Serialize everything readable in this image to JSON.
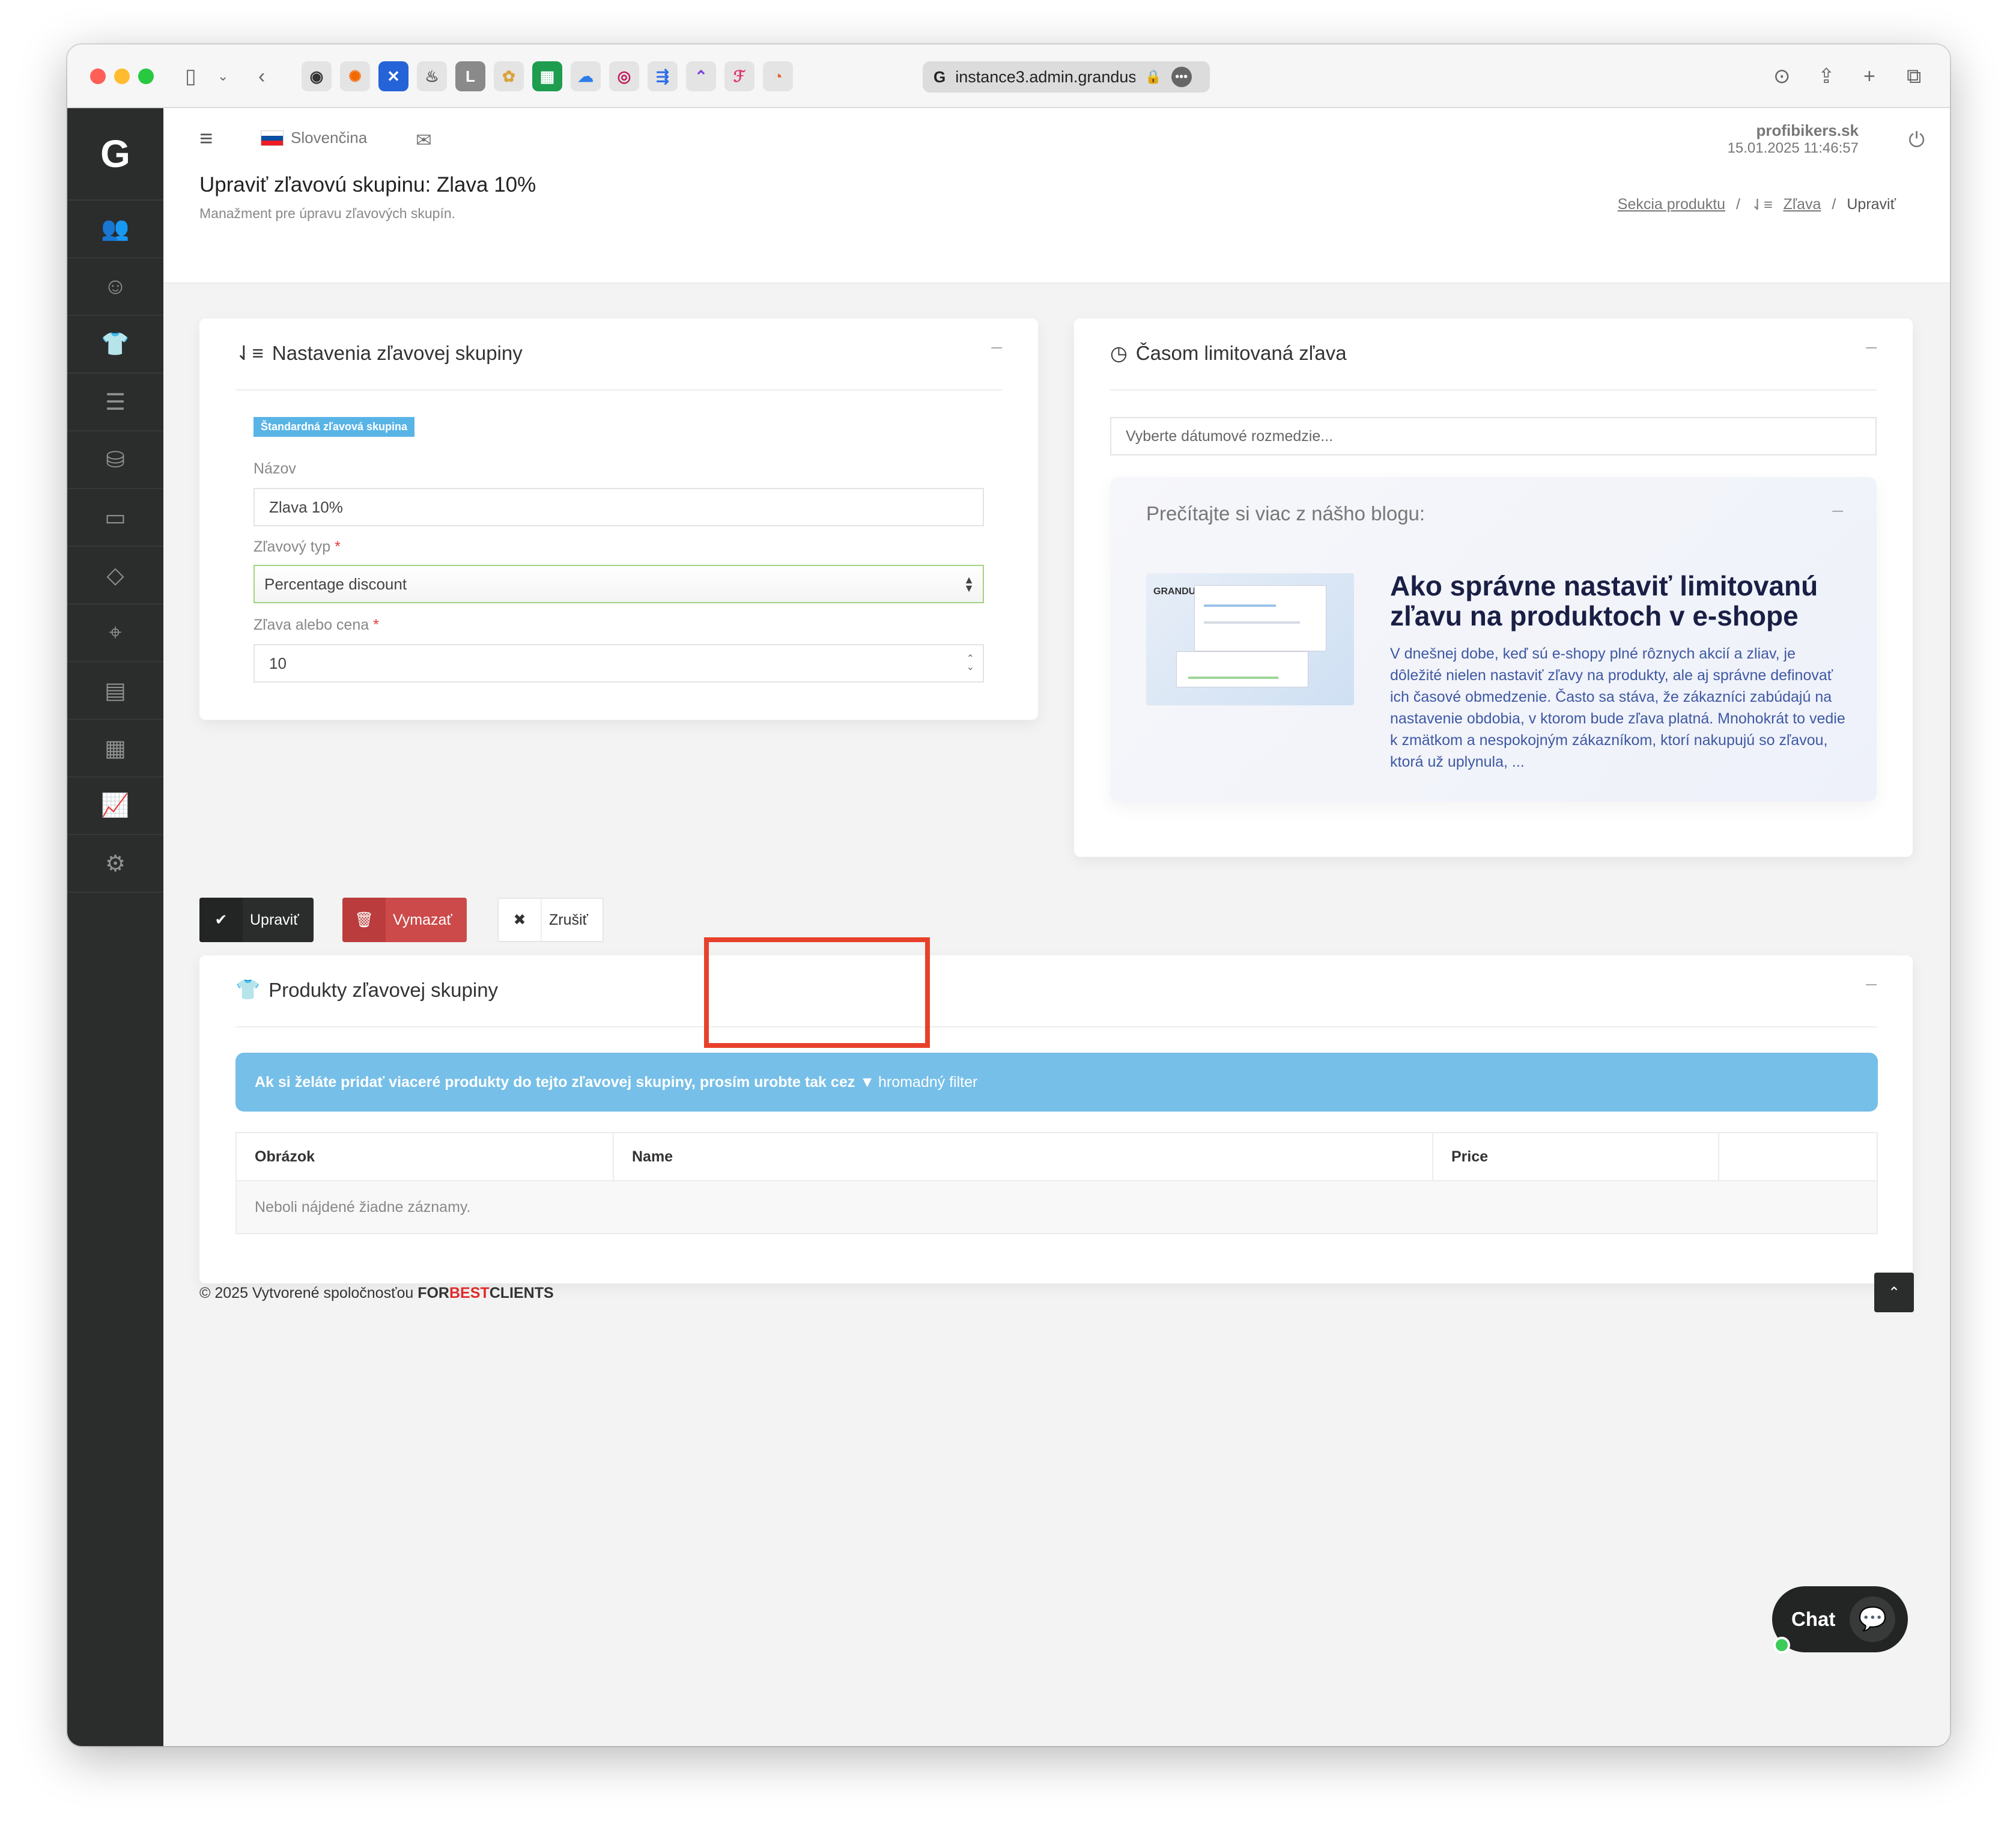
{
  "browser": {
    "url": "instance3.admin.grandus",
    "favicon": "G",
    "extensions": [
      "github-icon",
      "grafana-icon",
      "x-icon",
      "bell-icon",
      "L",
      "kanban-icon",
      "sheets-icon",
      "cloud-icon",
      "swirl-icon",
      "jira-icon",
      "clickup-icon",
      "figma-icon",
      "pie-icon"
    ]
  },
  "sidebar": {
    "logo": "G",
    "items": [
      {
        "icon": "users-icon",
        "glyph": "👥"
      },
      {
        "icon": "user-icon",
        "glyph": "☺"
      },
      {
        "icon": "tshirt-icon",
        "glyph": "👕"
      },
      {
        "icon": "list-icon",
        "glyph": "☰"
      },
      {
        "icon": "database-icon",
        "glyph": "⛁"
      },
      {
        "icon": "inbox-icon",
        "glyph": "▭"
      },
      {
        "icon": "tag-icon",
        "glyph": "◇"
      },
      {
        "icon": "map-marker-icon",
        "glyph": "⌖"
      },
      {
        "icon": "newspaper-icon",
        "glyph": "▤"
      },
      {
        "icon": "newspaper-alt-icon",
        "glyph": "▦"
      },
      {
        "icon": "chart-line-icon",
        "glyph": "📈"
      },
      {
        "icon": "settings-icon",
        "glyph": "⚙"
      }
    ]
  },
  "header": {
    "language": "Slovenčina",
    "shop": "profibikers.sk",
    "datetime": "15.01.2025 11:46:57",
    "title": "Upraviť zľavovú skupinu: Zlava 10%",
    "subtitle": "Manažment pre úpravu zľavových skupín.",
    "breadcrumb": {
      "item1": "Sekcia produktu",
      "sep": "/",
      "item2": "Zľava",
      "item3": "Upraviť"
    }
  },
  "settings_panel": {
    "title": "Nastavenia zľavovej skupiny",
    "badge": "Štandardná zľavová skupina",
    "name_label": "Názov",
    "name_value": "Zlava 10%",
    "type_label": "Zľavový typ",
    "type_value": "Percentage discount",
    "amount_label": "Zľava alebo cena",
    "amount_value": "10",
    "required_mark": "*"
  },
  "time_panel": {
    "title": "Časom limitovaná zľava",
    "date_placeholder": "Vyberte dátumové rozmedzie...",
    "blog_title": "Prečítajte si viac z nášho blogu:",
    "blog_image_logo": "GRANDUS",
    "blog_headline": "Ako správne nastaviť limitovanú zľavu na produktoch v e-shope",
    "blog_text": "V dnešnej dobe, keď sú e-shopy plné rôznych akcií a zliav, je dôležité nielen nastaviť zľavy na produkty, ale aj správne definovať ich časové obmedzenie. Často sa stáva, že zákazníci zabúdajú na nastavenie obdobia, v ktorom bude zľava platná. Mnohokrát to vedie k zmätkom a nespokojným zákazníkom, ktorí nakupujú so zľavou, ktorá už uplynula, ..."
  },
  "actions": {
    "update": "Upraviť",
    "delete": "Vymazať",
    "cancel": "Zrušiť"
  },
  "products_panel": {
    "title": "Produkty zľavovej skupiny",
    "info_text": "Ak si želáte pridať viaceré produkty do tejto zľavovej skupiny, prosím urobte tak cez",
    "filter_link": "hromadný filter",
    "columns": [
      "Obrázok",
      "Name",
      "Price",
      ""
    ],
    "empty": "Neboli nájdené žiadne záznamy."
  },
  "footer": {
    "text": "© 2025 Vytvorené spoločnosťou",
    "brand1": "FOR",
    "brand2": "BEST",
    "brand3": "CLIENTS"
  },
  "chat": {
    "label": "Chat"
  },
  "colors": {
    "sidebar": "#2b2c2c",
    "info_bar": "#76bfe8",
    "danger": "#cc4a4a",
    "highlight": "#e8412b",
    "blog_headline": "#1a1f45",
    "blog_text": "#3e58a3"
  }
}
